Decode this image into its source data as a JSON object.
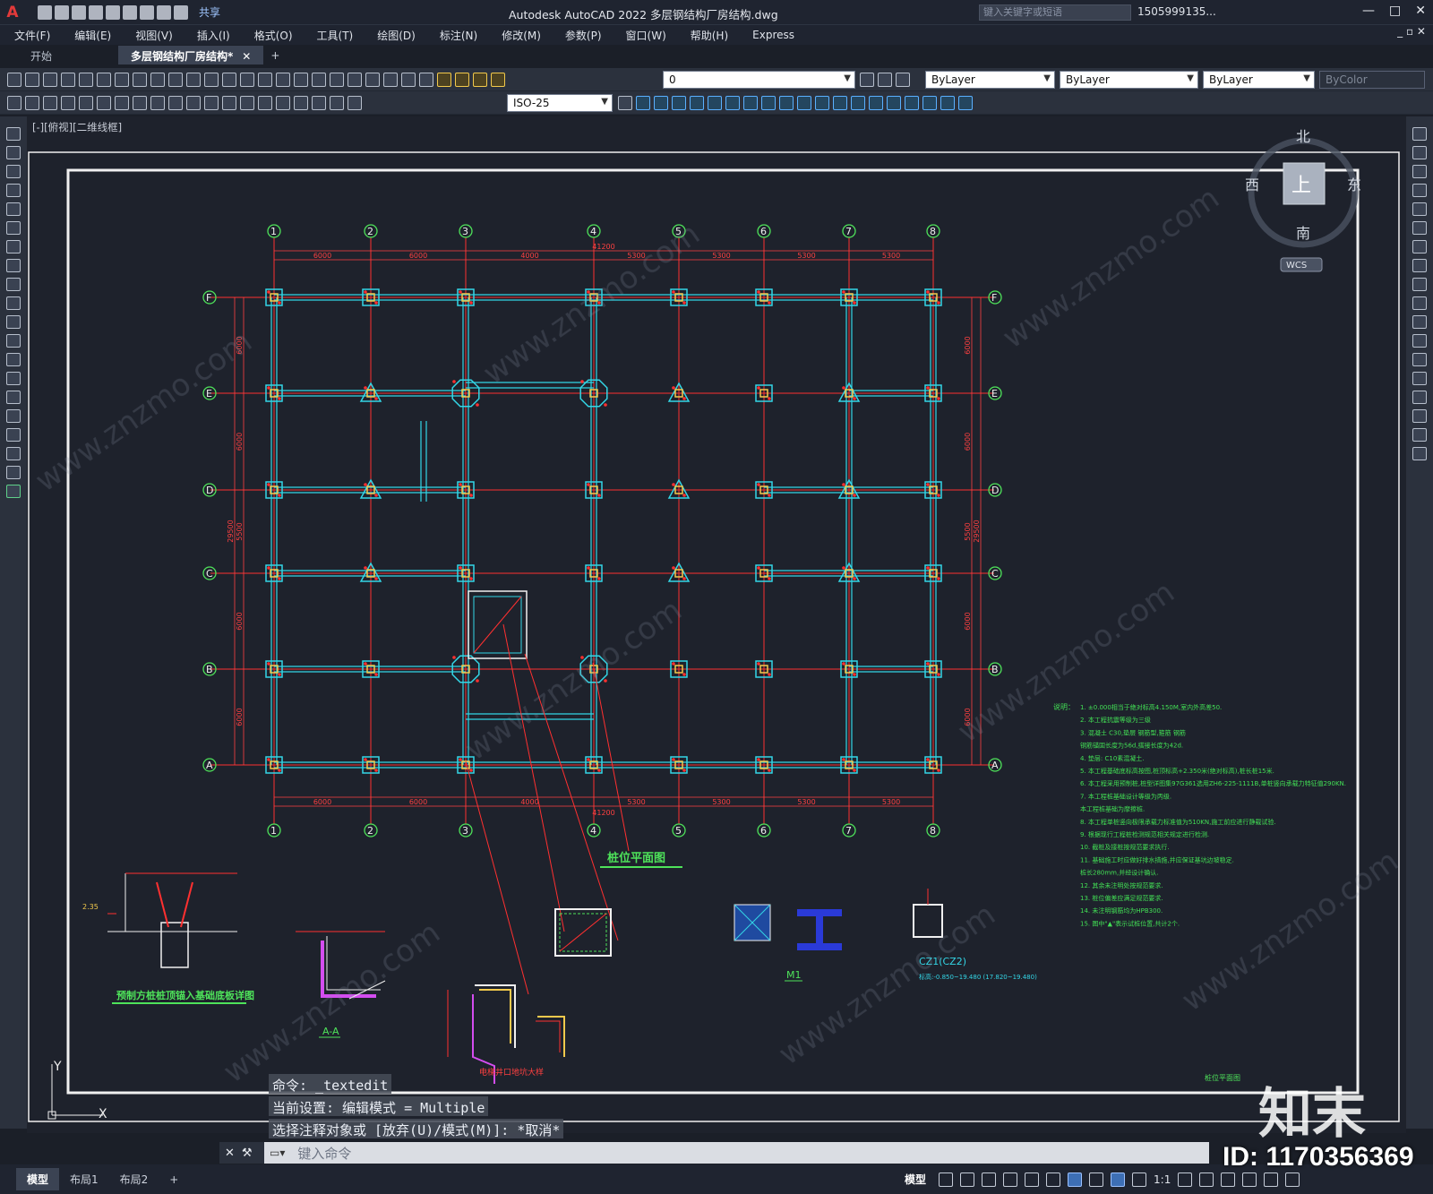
{
  "app": {
    "logo": "A",
    "share": "共享",
    "title": "Autodesk AutoCAD 2022    多层钢结构厂房结构.dwg",
    "search_placeholder": "键入关键字或短语",
    "user": "1505999135...",
    "window_controls": [
      "—",
      "□",
      "✕"
    ],
    "mdi_controls": "_ ▫ ✕"
  },
  "menu": [
    "文件(F)",
    "编辑(E)",
    "视图(V)",
    "插入(I)",
    "格式(O)",
    "工具(T)",
    "绘图(D)",
    "标注(N)",
    "修改(M)",
    "参数(P)",
    "窗口(W)",
    "帮助(H)",
    "Express"
  ],
  "tabs": {
    "start": "开始",
    "file": "多层钢结构厂房结构*",
    "close": "✕",
    "add": "+"
  },
  "toolbar": {
    "layer": "0",
    "dimstyle": "ISO-25",
    "color": "ByLayer",
    "linetype": "ByLayer",
    "lineweight": "ByLayer",
    "plotstyle": "ByColor"
  },
  "viewport": {
    "label": "[-][俯视][二维线框]",
    "compass": {
      "north": "北",
      "south": "南",
      "east": "东",
      "west": "西",
      "top": "上",
      "wcs": "WCS"
    }
  },
  "drawing": {
    "columns": [
      "1",
      "2",
      "3",
      "4",
      "5",
      "6",
      "7",
      "8"
    ],
    "rows": [
      "F",
      "E",
      "D",
      "C",
      "B",
      "A"
    ],
    "total_width": "41200",
    "total_height": "29500",
    "bay_widths": [
      "6000",
      "6000",
      "4000",
      "5300",
      "5300",
      "5300",
      "5300"
    ],
    "bay_heights": [
      "6000",
      "6000",
      "5500",
      "6000",
      "6000"
    ],
    "plan_title": "桩位平面图",
    "details": {
      "pile_detail_title": "预制方桩桩顶锚入基础底板详图",
      "section_aa": "A-A",
      "m1_label": "M1",
      "cz_label": "CZ1(CZ2)",
      "cz_note": "标高:-0.850~19.480 (17.820~19.480)",
      "stair_detail": "电梯井口地坑大样"
    },
    "notes_title": "说明：",
    "notes": [
      "1. ±0.000相当于绝对标高4.150M,室内外高差50.",
      "2. 本工程抗震等级为三级",
      "3. 混凝土 C30,垫层 钢筋型,箍筋 钢筋",
      "   钢筋锚固长度为56d,搭接长度为42d.",
      "4. 垫层: C10素混凝土.",
      "5. 本工程基础底标高按图,桩顶标高+2.350米(绝对标高),桩长桩15米.",
      "6. 本工程采用预制桩,桩型详图集97G361选用ZH6-225-1111B,单桩竖向承载力特征值290KN.",
      "7. 本工程桩基础设计等级为丙级.",
      "   本工程桩基础为摩擦桩.",
      "8. 本工程单桩竖向极限承载力标准值为510KN,施工前应进行静载试验.",
      "9. 根据现行工程桩检测规范相关规定进行检测.",
      "10. 截桩及接桩按规范要求执行.",
      "11. 基础施工时应做好排水措施,并应保证基坑边坡稳定.",
      "    桩长280mm,并经设计确认.",
      "12. 其余未注明处按规范要求.",
      "13. 桩位偏差应满足规范要求.",
      "14. 未注明钢筋均为HPB300.",
      "15. 图中\"▲\"表示试桩位置,共计2个."
    ],
    "sheet_title": "桩位平面图",
    "ucs": {
      "y": "Y",
      "x": "X"
    }
  },
  "command": {
    "history": [
      "命令: _textedit",
      "当前设置: 编辑模式 = Multiple",
      "选择注释对象或 [放弃(U)/模式(M)]: *取消*"
    ],
    "placeholder": "键入命令"
  },
  "status": {
    "layout_tabs": [
      "模型",
      "布局1",
      "布局2"
    ],
    "add": "+",
    "model": "模型",
    "scale": "1:1"
  },
  "watermark": {
    "site": "www.znzmo.com",
    "logo": "知末",
    "id": "ID: 1170356369"
  },
  "colors": {
    "grid_red": "#ff3030",
    "beam_cyan": "#33d6e6",
    "bubble_green": "#4ee35a",
    "dim_red": "#ff4040",
    "note_green": "#42e055",
    "frame_white": "#f0f0f0"
  }
}
